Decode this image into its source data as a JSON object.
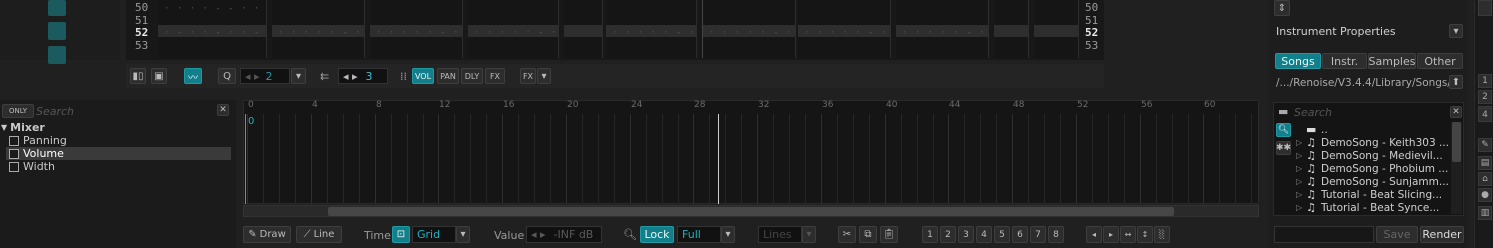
{
  "pattern": {
    "left_rows": [
      "50",
      "51",
      "52",
      "53"
    ],
    "right_rows": [
      "50",
      "51",
      "52",
      "53"
    ],
    "current_row": "52"
  },
  "pattern_toolbar": {
    "lpb_value": "2",
    "step_value": "3",
    "col_vol": "VOL",
    "col_pan": "PAN",
    "col_dly": "DLY",
    "col_fx": "FX",
    "fx_menu": "FX"
  },
  "automation_tree": {
    "filter_label": "ONLY",
    "search_placeholder": "Search",
    "group": "Mixer",
    "items": [
      "Panning",
      "Volume",
      "Width"
    ]
  },
  "automation_editor": {
    "ruler": [
      "0",
      "4",
      "8",
      "12",
      "16",
      "20",
      "24",
      "28",
      "32",
      "36",
      "40",
      "44",
      "48",
      "52",
      "56",
      "60"
    ],
    "marker_value": "0"
  },
  "automation_toolbar": {
    "draw": "Draw",
    "line": "Line",
    "time_label": "Time",
    "time_mode": "Grid",
    "value_label": "Value",
    "value_readout": "-INF dB",
    "lock": "Lock",
    "lock_mode": "Full",
    "interp": "Lines",
    "presets": [
      "1",
      "2",
      "3",
      "4",
      "5",
      "6",
      "7",
      "8"
    ]
  },
  "right_panel": {
    "title": "Instrument Properties",
    "tabs": [
      "Songs",
      "Instr.",
      "Samples",
      "Other"
    ],
    "active_tab": "Songs",
    "path": "/.../Renoise/V3.4.4/Library/Songs/",
    "search_placeholder": "Search",
    "parent": "..",
    "files": [
      "DemoSong - Keith303 ...",
      "DemoSong - Medievil...",
      "DemoSong - Phobium ...",
      "DemoSong - Sunjamm...",
      "Tutorial - Beat Slicing...",
      "Tutorial - Beat Synce..."
    ],
    "save": "Save",
    "render": "Render"
  },
  "colors": {
    "accent": "#127f8a",
    "background": "#202020",
    "panel": "#1b1b1b"
  }
}
